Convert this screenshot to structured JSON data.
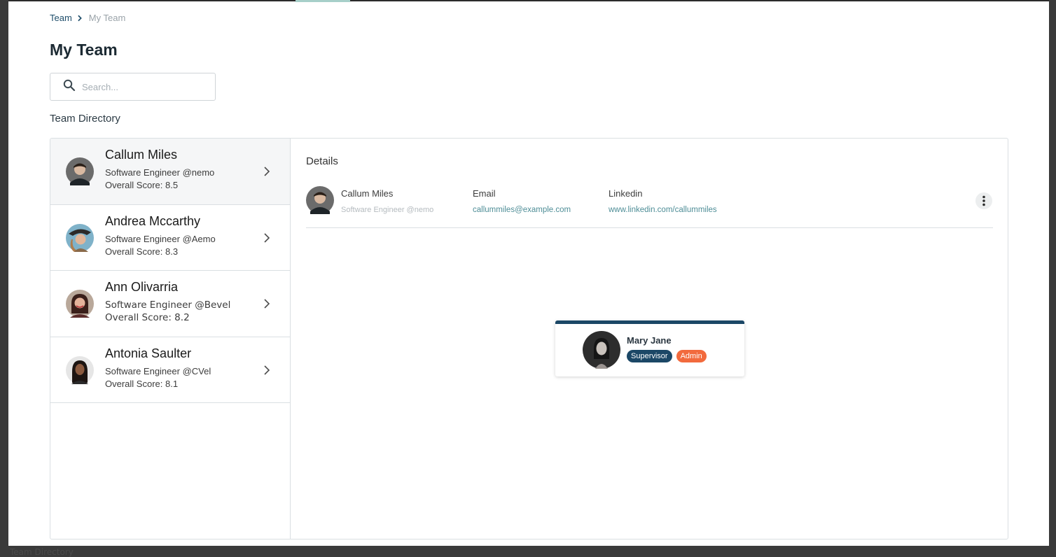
{
  "breadcrumb": {
    "parent": "Team",
    "current": "My Team"
  },
  "page": {
    "title": "My Team"
  },
  "search": {
    "placeholder": "Search..."
  },
  "directory": {
    "title": "Team Directory"
  },
  "members": [
    {
      "name": "Callum Miles",
      "role": "Software Engineer @nemo",
      "score": "Overall Score: 8.5"
    },
    {
      "name": "Andrea Mccarthy",
      "role": "Software Engineer @Aemo",
      "score": "Overall Score: 8.3"
    },
    {
      "name": "Ann Olivarria",
      "role": "Software Engineer @Bevel",
      "score": "Overall Score: 8.2"
    },
    {
      "name": "Antonia Saulter",
      "role": "Software Engineer @CVel",
      "score": "Overall Score: 8.1"
    }
  ],
  "details": {
    "title": "Details",
    "name": "Callum Miles",
    "role": "Software Engineer @nemo",
    "email_label": "Email",
    "email": "callummiles@example.com",
    "linkedin_label": "Linkedin",
    "linkedin": "www.linkedin.com/callummiles"
  },
  "supervisor_card": {
    "name": "Mary Jane",
    "badges": [
      "Supervisor",
      "Admin"
    ]
  },
  "footer_ghost": "Team Directory",
  "colors": {
    "primary": "#1b4766",
    "accent": "#f26a3d",
    "link": "#4f8e97"
  },
  "icons": [
    "search-icon",
    "chevron-right-icon",
    "more-vertical-icon"
  ]
}
